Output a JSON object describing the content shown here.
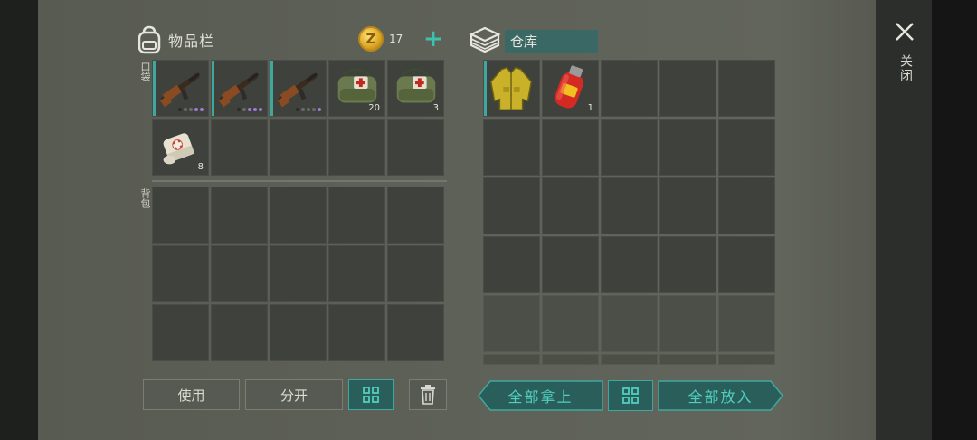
{
  "inventory": {
    "title": "物品栏",
    "coin_icon": "Z",
    "coins": "17",
    "pocket_label": "口袋",
    "backpack_label": "背包",
    "pocket_items": [
      {
        "name": "AK Rifle",
        "qty": ""
      },
      {
        "name": "AK Rifle",
        "qty": ""
      },
      {
        "name": "AK Rifle",
        "qty": ""
      },
      {
        "name": "Medical Bag",
        "qty": "20"
      },
      {
        "name": "Medical Bag",
        "qty": "3"
      },
      {
        "name": "Bandage",
        "qty": "8"
      }
    ]
  },
  "buttons": {
    "use": "使用",
    "split": "分开",
    "take_all": "全部拿上",
    "put_all": "全部放入"
  },
  "warehouse": {
    "title": "仓库",
    "items": [
      {
        "name": "Yellow Jacket",
        "qty": ""
      },
      {
        "name": "Gas Canister",
        "qty": "1"
      }
    ]
  },
  "close": {
    "label": "关闭"
  },
  "colors": {
    "accent": "#3fa89e",
    "teal_text": "#4fd0c0",
    "cell": "#3e413c",
    "panel": "#5e6158"
  }
}
